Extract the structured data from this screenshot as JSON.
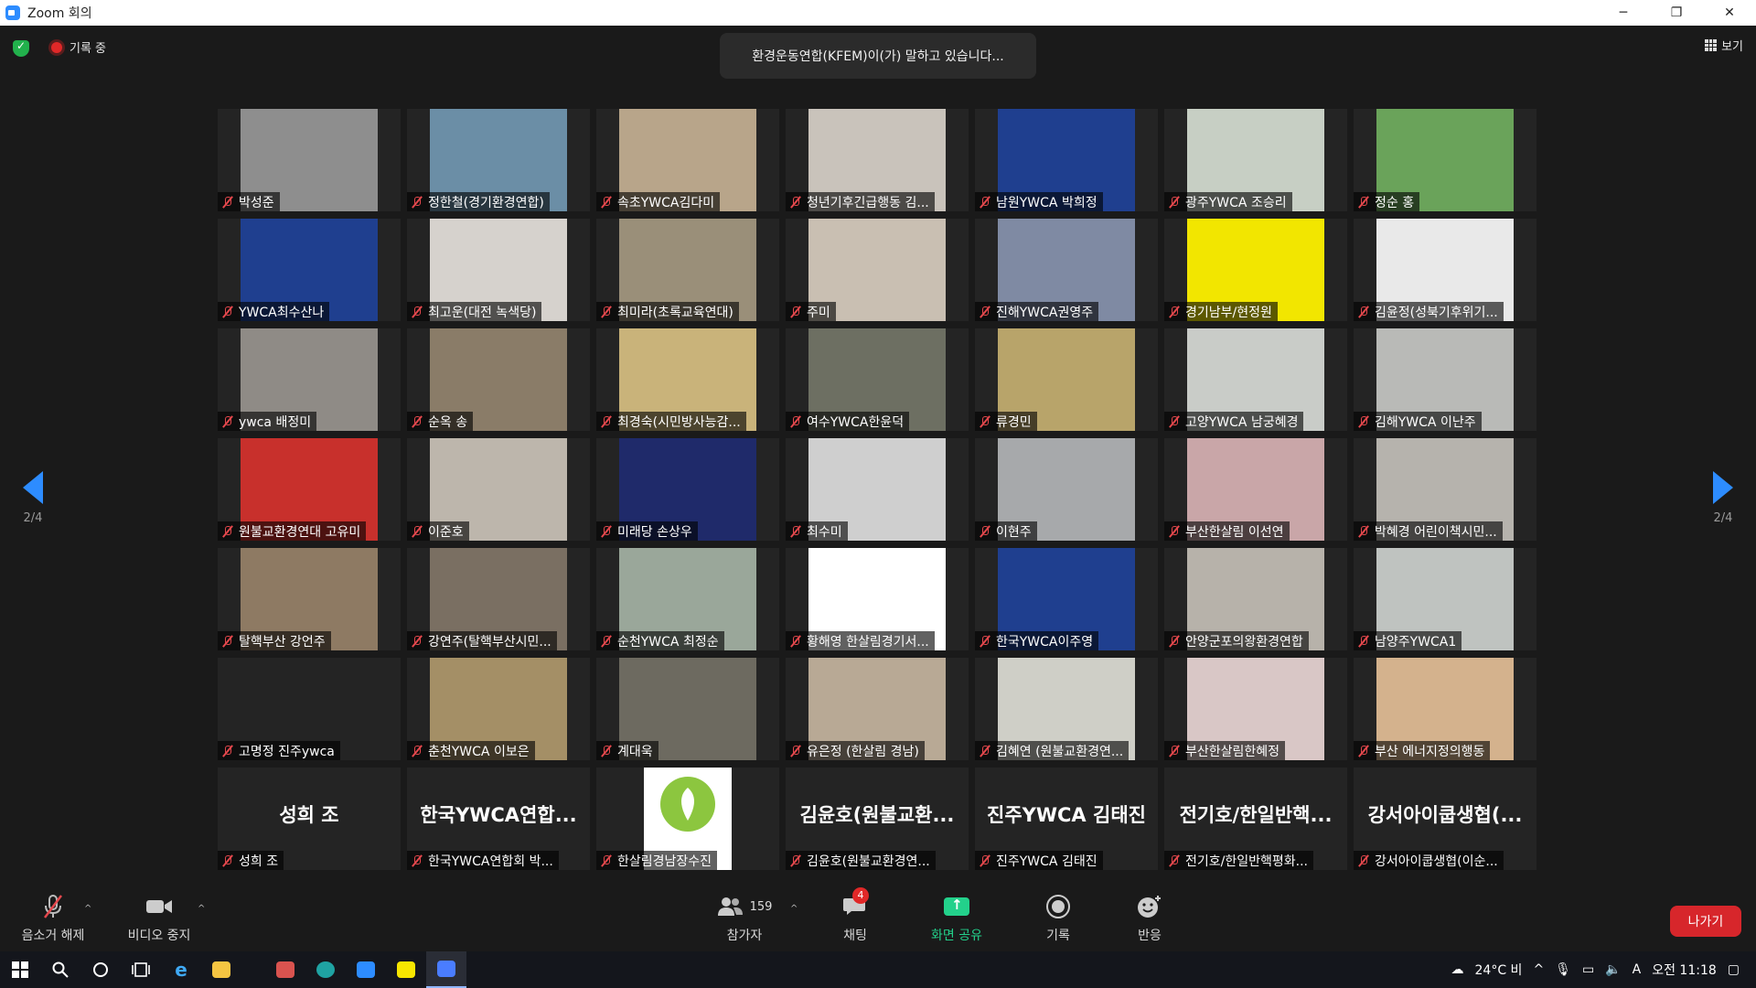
{
  "window": {
    "title": "Zoom 회의",
    "controls": [
      "─",
      "❐",
      "✕"
    ]
  },
  "topbar": {
    "recording_label": "기록 중",
    "speaking_banner": "환경운동연합(KFEM)이(가) 말하고 있습니다...",
    "view_label": "보기"
  },
  "tiles": [
    {
      "name": "박성준",
      "bg": "#8e8e8e"
    },
    {
      "name": "정한철(경기환경연합)",
      "bg": "#6b8ea6"
    },
    {
      "name": "속초YWCA김다미",
      "bg": "#b8a58a"
    },
    {
      "name": "청년기후긴급행동 김...",
      "bg": "#c9c3bb"
    },
    {
      "name": "남원YWCA 박희정",
      "bg": "#1f3f8f"
    },
    {
      "name": "광주YWCA 조승리",
      "bg": "#c7cfc4"
    },
    {
      "name": "정순 홍",
      "bg": "#6aa35a"
    },
    {
      "name": "YWCA최수산나",
      "bg": "#1f3f8f"
    },
    {
      "name": "최고운(대전 녹색당)",
      "bg": "#d6d2cd"
    },
    {
      "name": "최미라(초록교육연대)",
      "bg": "#9a8f79"
    },
    {
      "name": "주미",
      "bg": "#c9bfb2"
    },
    {
      "name": "진해YWCA권영주",
      "bg": "#7f8aa3"
    },
    {
      "name": "경기남부/현정원",
      "bg": "#f2e600"
    },
    {
      "name": "김윤정(성북기후위기...",
      "bg": "#e9e9e9"
    },
    {
      "name": "ywca 배정미",
      "bg": "#8f8b86"
    },
    {
      "name": "순옥 송",
      "bg": "#8a7c68"
    },
    {
      "name": "최경숙(시민방사능감...",
      "bg": "#c9b37a"
    },
    {
      "name": "여수YWCA한윤덕",
      "bg": "#6d6f62"
    },
    {
      "name": "류경민",
      "bg": "#b8a46a"
    },
    {
      "name": "고양YWCA 남궁혜경",
      "bg": "#c9ccc8"
    },
    {
      "name": "김해YWCA 이난주",
      "bg": "#b9bab7"
    },
    {
      "name": "원불교환경연대 고유미",
      "bg": "#c8302c"
    },
    {
      "name": "이준호",
      "bg": "#bdb6ac"
    },
    {
      "name": "미래당 손상우",
      "bg": "#1f2a6a"
    },
    {
      "name": "최수미",
      "bg": "#cfcfcf"
    },
    {
      "name": "이현주",
      "bg": "#a7a9ab"
    },
    {
      "name": "부산한살림 이선연",
      "bg": "#c9a6a8"
    },
    {
      "name": "박혜경 어린이책시민...",
      "bg": "#b6b3ad"
    },
    {
      "name": "탈핵부산 강언주",
      "bg": "#8e7a63"
    },
    {
      "name": "강연주(탈핵부산시민...",
      "bg": "#7a6f62"
    },
    {
      "name": "순천YWCA 최정순",
      "bg": "#9aa79a"
    },
    {
      "name": "황해영 한살림경기서...",
      "bg": "#ffffff"
    },
    {
      "name": "한국YWCA이주영",
      "bg": "#1f3f8f"
    },
    {
      "name": "안양군포의왕환경연합",
      "bg": "#b7b2aa"
    },
    {
      "name": "남양주YWCA1",
      "bg": "#bfc3c0"
    },
    {
      "name": "고명정 진주ywca",
      "bg": ""
    },
    {
      "name": "춘천YWCA 이보은",
      "bg": "#a48f66"
    },
    {
      "name": "계대욱",
      "bg": "#6d6a60"
    },
    {
      "name": "유은정 (한살림 경남)",
      "bg": "#b8a995"
    },
    {
      "name": "김혜연 (원불교환경연...",
      "bg": "#cfcfc7"
    },
    {
      "name": "부산한살림한혜정",
      "bg": "#d9c7c6"
    },
    {
      "name": "부산 에너지정의행동",
      "bg": "#d4b28d"
    },
    {
      "name": "성희 조",
      "big": "성희 조"
    },
    {
      "name": "한국YWCA연합회 박...",
      "big": "한국YWCA연합..."
    },
    {
      "name": "한살림경남장수진",
      "bg": "#ffffff",
      "logo": true
    },
    {
      "name": "김윤호(원불교환경연...",
      "big": "김윤호(원불교환..."
    },
    {
      "name": "진주YWCA 김태진",
      "big": "진주YWCA 김태진"
    },
    {
      "name": "전기호/한일반핵평화...",
      "big": "전기호/한일반핵..."
    },
    {
      "name": "강서아이쿱생협(이순...",
      "big": "강서아이쿱생협(..."
    }
  ],
  "pagination": {
    "left": "2/4",
    "right": "2/4"
  },
  "toolbar": {
    "mute_label": "음소거 해제",
    "video_label": "비디오 중지",
    "participants_label": "참가자",
    "participants_count": "159",
    "chat_label": "채팅",
    "chat_badge": "4",
    "share_label": "화면 공유",
    "record_label": "기록",
    "reactions_label": "반응",
    "leave_label": "나가기"
  },
  "taskbar": {
    "weather": "24°C 비",
    "ime": "A",
    "clock": "오전 11:18"
  },
  "colors": {
    "accent": "#2d8cff",
    "share_green": "#23d18b",
    "leave_red": "#d7262b",
    "muted_red": "#e5484d"
  }
}
